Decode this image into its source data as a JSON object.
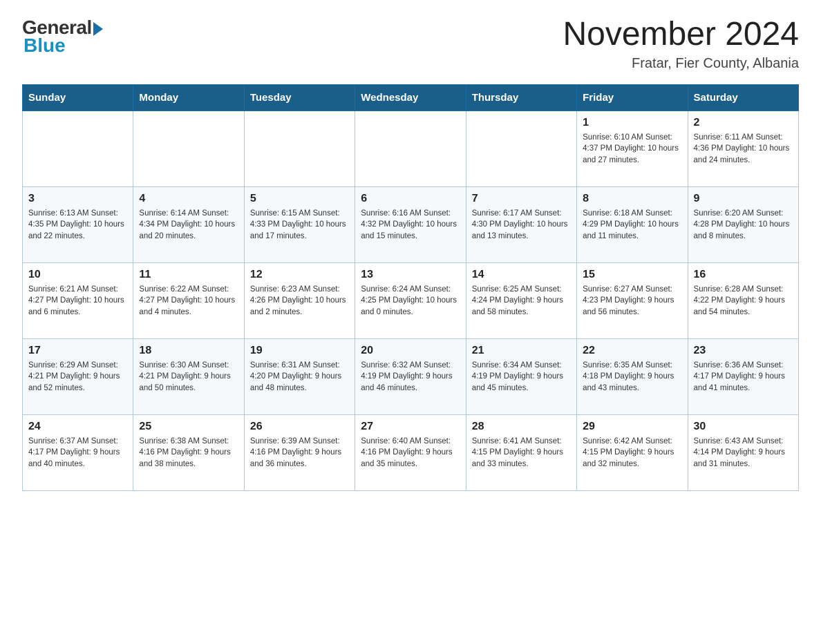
{
  "header": {
    "logo_general": "General",
    "logo_blue": "Blue",
    "month_year": "November 2024",
    "location": "Fratar, Fier County, Albania"
  },
  "weekdays": [
    "Sunday",
    "Monday",
    "Tuesday",
    "Wednesday",
    "Thursday",
    "Friday",
    "Saturday"
  ],
  "weeks": [
    [
      {
        "day": "",
        "info": ""
      },
      {
        "day": "",
        "info": ""
      },
      {
        "day": "",
        "info": ""
      },
      {
        "day": "",
        "info": ""
      },
      {
        "day": "",
        "info": ""
      },
      {
        "day": "1",
        "info": "Sunrise: 6:10 AM\nSunset: 4:37 PM\nDaylight: 10 hours\nand 27 minutes."
      },
      {
        "day": "2",
        "info": "Sunrise: 6:11 AM\nSunset: 4:36 PM\nDaylight: 10 hours\nand 24 minutes."
      }
    ],
    [
      {
        "day": "3",
        "info": "Sunrise: 6:13 AM\nSunset: 4:35 PM\nDaylight: 10 hours\nand 22 minutes."
      },
      {
        "day": "4",
        "info": "Sunrise: 6:14 AM\nSunset: 4:34 PM\nDaylight: 10 hours\nand 20 minutes."
      },
      {
        "day": "5",
        "info": "Sunrise: 6:15 AM\nSunset: 4:33 PM\nDaylight: 10 hours\nand 17 minutes."
      },
      {
        "day": "6",
        "info": "Sunrise: 6:16 AM\nSunset: 4:32 PM\nDaylight: 10 hours\nand 15 minutes."
      },
      {
        "day": "7",
        "info": "Sunrise: 6:17 AM\nSunset: 4:30 PM\nDaylight: 10 hours\nand 13 minutes."
      },
      {
        "day": "8",
        "info": "Sunrise: 6:18 AM\nSunset: 4:29 PM\nDaylight: 10 hours\nand 11 minutes."
      },
      {
        "day": "9",
        "info": "Sunrise: 6:20 AM\nSunset: 4:28 PM\nDaylight: 10 hours\nand 8 minutes."
      }
    ],
    [
      {
        "day": "10",
        "info": "Sunrise: 6:21 AM\nSunset: 4:27 PM\nDaylight: 10 hours\nand 6 minutes."
      },
      {
        "day": "11",
        "info": "Sunrise: 6:22 AM\nSunset: 4:27 PM\nDaylight: 10 hours\nand 4 minutes."
      },
      {
        "day": "12",
        "info": "Sunrise: 6:23 AM\nSunset: 4:26 PM\nDaylight: 10 hours\nand 2 minutes."
      },
      {
        "day": "13",
        "info": "Sunrise: 6:24 AM\nSunset: 4:25 PM\nDaylight: 10 hours\nand 0 minutes."
      },
      {
        "day": "14",
        "info": "Sunrise: 6:25 AM\nSunset: 4:24 PM\nDaylight: 9 hours\nand 58 minutes."
      },
      {
        "day": "15",
        "info": "Sunrise: 6:27 AM\nSunset: 4:23 PM\nDaylight: 9 hours\nand 56 minutes."
      },
      {
        "day": "16",
        "info": "Sunrise: 6:28 AM\nSunset: 4:22 PM\nDaylight: 9 hours\nand 54 minutes."
      }
    ],
    [
      {
        "day": "17",
        "info": "Sunrise: 6:29 AM\nSunset: 4:21 PM\nDaylight: 9 hours\nand 52 minutes."
      },
      {
        "day": "18",
        "info": "Sunrise: 6:30 AM\nSunset: 4:21 PM\nDaylight: 9 hours\nand 50 minutes."
      },
      {
        "day": "19",
        "info": "Sunrise: 6:31 AM\nSunset: 4:20 PM\nDaylight: 9 hours\nand 48 minutes."
      },
      {
        "day": "20",
        "info": "Sunrise: 6:32 AM\nSunset: 4:19 PM\nDaylight: 9 hours\nand 46 minutes."
      },
      {
        "day": "21",
        "info": "Sunrise: 6:34 AM\nSunset: 4:19 PM\nDaylight: 9 hours\nand 45 minutes."
      },
      {
        "day": "22",
        "info": "Sunrise: 6:35 AM\nSunset: 4:18 PM\nDaylight: 9 hours\nand 43 minutes."
      },
      {
        "day": "23",
        "info": "Sunrise: 6:36 AM\nSunset: 4:17 PM\nDaylight: 9 hours\nand 41 minutes."
      }
    ],
    [
      {
        "day": "24",
        "info": "Sunrise: 6:37 AM\nSunset: 4:17 PM\nDaylight: 9 hours\nand 40 minutes."
      },
      {
        "day": "25",
        "info": "Sunrise: 6:38 AM\nSunset: 4:16 PM\nDaylight: 9 hours\nand 38 minutes."
      },
      {
        "day": "26",
        "info": "Sunrise: 6:39 AM\nSunset: 4:16 PM\nDaylight: 9 hours\nand 36 minutes."
      },
      {
        "day": "27",
        "info": "Sunrise: 6:40 AM\nSunset: 4:16 PM\nDaylight: 9 hours\nand 35 minutes."
      },
      {
        "day": "28",
        "info": "Sunrise: 6:41 AM\nSunset: 4:15 PM\nDaylight: 9 hours\nand 33 minutes."
      },
      {
        "day": "29",
        "info": "Sunrise: 6:42 AM\nSunset: 4:15 PM\nDaylight: 9 hours\nand 32 minutes."
      },
      {
        "day": "30",
        "info": "Sunrise: 6:43 AM\nSunset: 4:14 PM\nDaylight: 9 hours\nand 31 minutes."
      }
    ]
  ]
}
